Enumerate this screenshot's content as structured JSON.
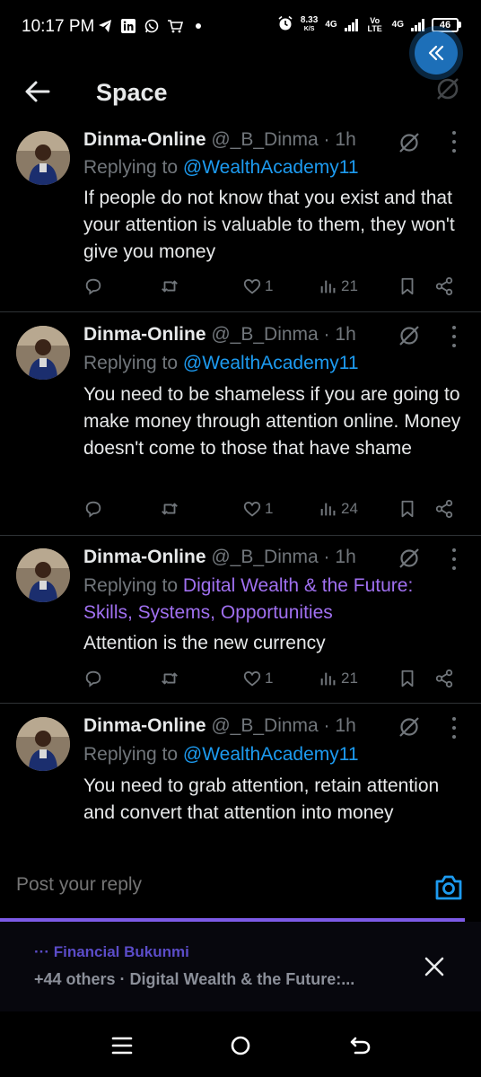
{
  "status_bar": {
    "time": "10:17 PM",
    "speed": "8.33",
    "speed_unit": "K/S",
    "network_1": "4G",
    "network_2": "4G",
    "volte": "Vo LTE",
    "battery": "46",
    "icons": [
      "telegram-icon",
      "linkedin-icon",
      "whatsapp-icon",
      "shop-icon",
      "dot-icon",
      "alarm-icon"
    ]
  },
  "header": {
    "title": "Space"
  },
  "tweets": [
    {
      "name": "Dinma-Online",
      "handle": "@_B_Dinma · 1h",
      "reply_prefix": "Replying to ",
      "reply_target": "@WealthAcademy11",
      "reply_target_2": "",
      "body": "If people do not know that you exist and that your attention is valuable to them, they won't give you money",
      "likes": "1",
      "views": "21"
    },
    {
      "name": "Dinma-Online",
      "handle": "@_B_Dinma · 1h",
      "reply_prefix": "Replying to ",
      "reply_target": "@WealthAcademy11",
      "reply_target_2": "",
      "body": "You need to be shameless if you are going to make money through attention online. Money doesn't come to those that have shame",
      "likes": "1",
      "views": "24"
    },
    {
      "name": "Dinma-Online",
      "handle": "@_B_Dinma · 1h",
      "reply_prefix": "Replying to ",
      "reply_target": "Digital Wealth & the Future:",
      "reply_target_2": "Skills, Systems, Opportunities",
      "body": "Attention is the new currency",
      "likes": "1",
      "views": "21"
    },
    {
      "name": "Dinma-Online",
      "handle": "@_B_Dinma · 1h",
      "reply_prefix": "Replying to ",
      "reply_target": "@WealthAcademy11",
      "reply_target_2": "",
      "body": "You need to grab attention, retain attention and convert that attention into money",
      "likes": "",
      "views": ""
    }
  ],
  "reply_box": {
    "placeholder": "Post your reply"
  },
  "space_bar": {
    "host": "··· Financial Bukunmi",
    "subtitle": "+44 others · Digital Wealth & the Future:..."
  },
  "colors": {
    "accent": "#1d9bf0",
    "space_purple": "#7c5ae6",
    "muted": "#71767b"
  }
}
